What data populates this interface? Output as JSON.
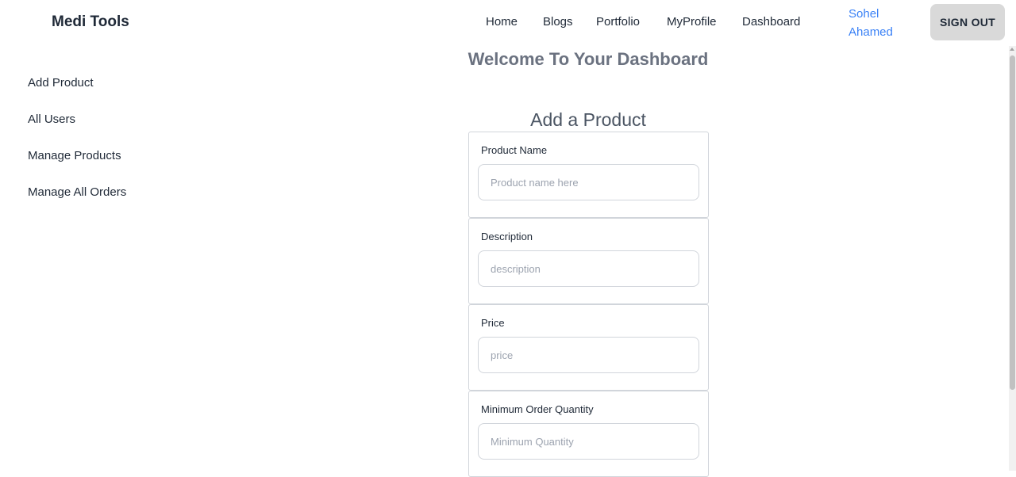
{
  "navbar": {
    "brand": "Medi Tools",
    "links": {
      "home": "Home",
      "blogs": "Blogs",
      "portfolio": "Portfolio",
      "myprofile": "MyProfile",
      "dashboard": "Dashboard"
    },
    "user_name": "Sohel Ahamed",
    "signout_label": "SIGN OUT"
  },
  "sidebar": {
    "items": [
      {
        "label": "Add Product"
      },
      {
        "label": "All Users"
      },
      {
        "label": "Manage Products"
      },
      {
        "label": "Manage All Orders"
      }
    ]
  },
  "main": {
    "title": "Welcome To Your Dashboard",
    "form": {
      "title": "Add a Product",
      "fields": [
        {
          "label": "Product Name",
          "placeholder": "Product name here",
          "value": ""
        },
        {
          "label": "Description",
          "placeholder": "description",
          "value": ""
        },
        {
          "label": "Price",
          "placeholder": "price",
          "value": ""
        },
        {
          "label": "Minimum Order Quantity",
          "placeholder": "Minimum Quantity",
          "value": ""
        }
      ]
    }
  },
  "colors": {
    "user_link": "#3b82f6",
    "signout_bg": "#d9d9d9",
    "title_gray": "#6b7280"
  }
}
